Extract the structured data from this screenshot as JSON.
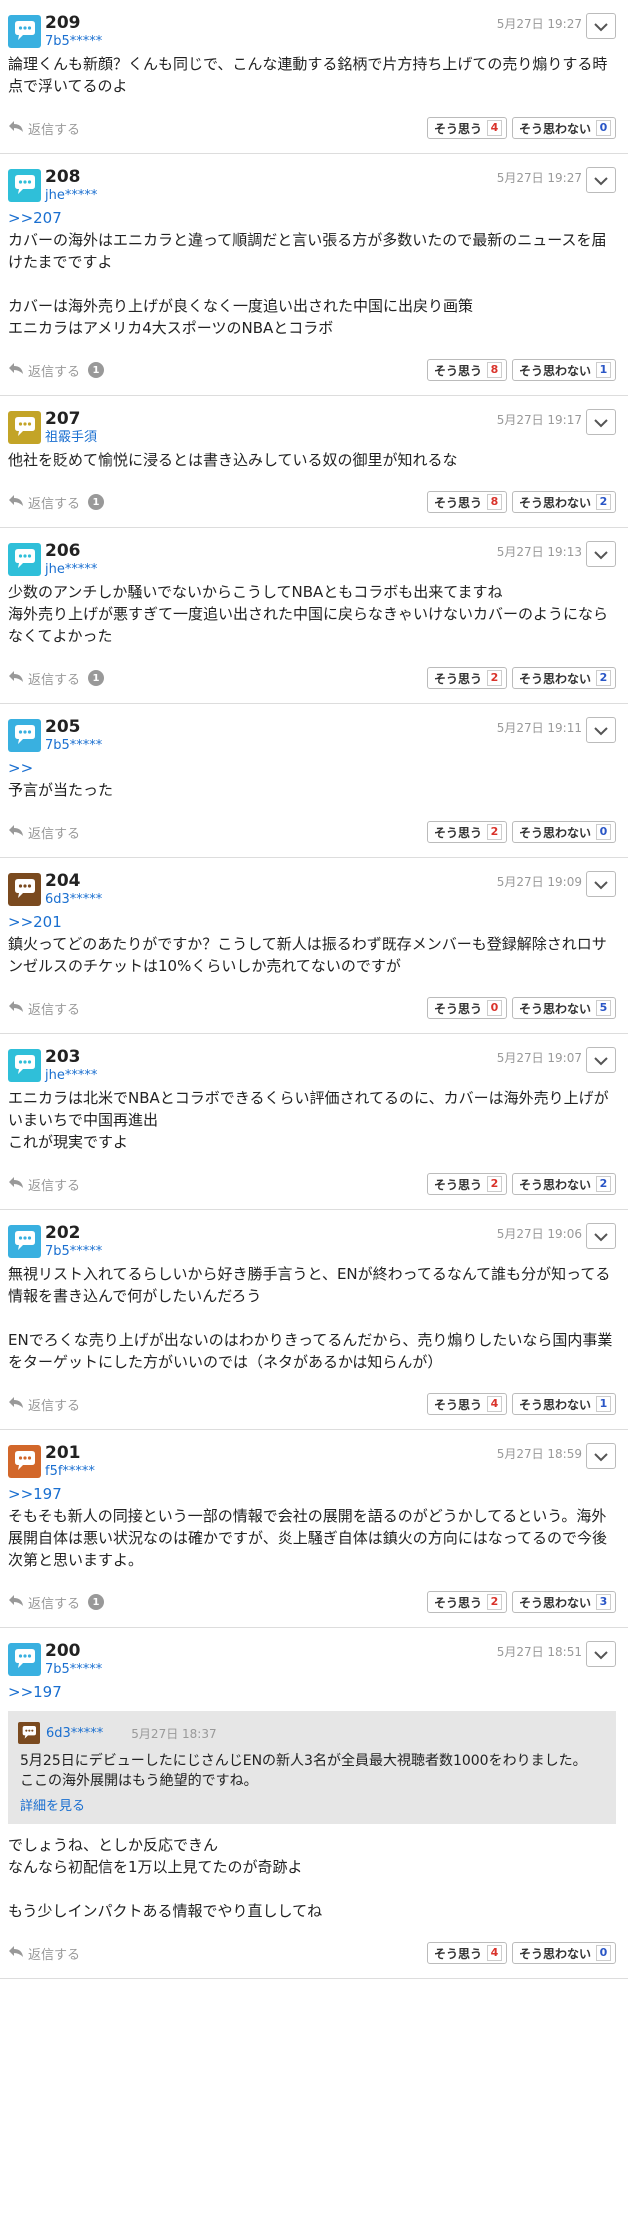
{
  "labels": {
    "reply": "返信する",
    "agree": "そう思う",
    "disagree": "そう思わない",
    "details": "詳細を見る"
  },
  "colors": {
    "link": "#1a6fd0",
    "agree_count": "#d9332b",
    "disagree_count": "#2a56c6"
  },
  "posts": [
    {
      "number": "209",
      "user": "7b5*****",
      "date": "5月27日 19:27",
      "avatar": {
        "icon": "speech-bubble-icon",
        "color": "#39b0e0"
      },
      "reply_to": "",
      "text": "論理くんも新顔？くんも同じで、こんな連動する銘柄で片方持ち上げての売り煽りする時点で浮いてるのよ",
      "reply_count": "",
      "agree": "4",
      "disagree": "0"
    },
    {
      "number": "208",
      "user": "jhe*****",
      "date": "5月27日 19:27",
      "avatar": {
        "icon": "speech-bubble-icon",
        "color": "#2fbfd9"
      },
      "reply_to": ">>207",
      "text": "カバーの海外はエニカラと違って順調だと言い張る方が多数いたので最新のニュースを届けたまでですよ\n\nカバーは海外売り上げが良くなく一度追い出された中国に出戻り画策\nエニカラはアメリカ4大スポーツのNBAとコラボ",
      "reply_count": "1",
      "agree": "8",
      "disagree": "1"
    },
    {
      "number": "207",
      "user": "祖霰手須",
      "date": "5月27日 19:17",
      "avatar": {
        "icon": "speech-bubble-icon",
        "color": "#c3a427"
      },
      "reply_to": "",
      "text": "他社を貶めて愉悦に浸るとは書き込みしている奴の御里が知れるな",
      "reply_count": "1",
      "agree": "8",
      "disagree": "2"
    },
    {
      "number": "206",
      "user": "jhe*****",
      "date": "5月27日 19:13",
      "avatar": {
        "icon": "speech-bubble-icon",
        "color": "#2fbfd9"
      },
      "reply_to": "",
      "text": "少数のアンチしか騒いでないからこうしてNBAともコラボも出来てますね\n海外売り上げが悪すぎて一度追い出された中国に戻らなきゃいけないカバーのようにならなくてよかった",
      "reply_count": "1",
      "agree": "2",
      "disagree": "2"
    },
    {
      "number": "205",
      "user": "7b5*****",
      "date": "5月27日 19:11",
      "avatar": {
        "icon": "speech-bubble-icon",
        "color": "#39b0e0"
      },
      "reply_to": ">>",
      "text": "予言が当たった",
      "reply_count": "",
      "agree": "2",
      "disagree": "0"
    },
    {
      "number": "204",
      "user": "6d3*****",
      "date": "5月27日 19:09",
      "avatar": {
        "icon": "speech-bubble-icon",
        "color": "#7a4a1f"
      },
      "reply_to": ">>201",
      "text": "鎮火ってどのあたりがですか？こうして新人は振るわず既存メンバーも登録解除されロサンゼルスのチケットは10%くらいしか売れてないのですが",
      "reply_count": "",
      "agree": "0",
      "disagree": "5"
    },
    {
      "number": "203",
      "user": "jhe*****",
      "date": "5月27日 19:07",
      "avatar": {
        "icon": "speech-bubble-icon",
        "color": "#2fbfd9"
      },
      "reply_to": "",
      "text": "エニカラは北米でNBAとコラボできるくらい評価されてるのに、カバーは海外売り上げがいまいちで中国再進出\nこれが現実ですよ",
      "reply_count": "",
      "agree": "2",
      "disagree": "2"
    },
    {
      "number": "202",
      "user": "7b5*****",
      "date": "5月27日 19:06",
      "avatar": {
        "icon": "speech-bubble-icon",
        "color": "#39b0e0"
      },
      "reply_to": "",
      "text": "無視リスト入れてるらしいから好き勝手言うと、ENが終わってるなんて誰も分が知ってる情報を書き込んで何がしたいんだろう\n\nENでろくな売り上げが出ないのはわかりきってるんだから、売り煽りしたいなら国内事業をターゲットにした方がいいのでは（ネタがあるかは知らんが）",
      "reply_count": "",
      "agree": "4",
      "disagree": "1"
    },
    {
      "number": "201",
      "user": "f5f*****",
      "date": "5月27日 18:59",
      "avatar": {
        "icon": "speech-bubble-icon",
        "color": "#d2672a"
      },
      "reply_to": ">>197",
      "text": "そもそも新人の同接という一部の情報で会社の展開を語るのがどうかしてるという。海外展開自体は悪い状況なのは確かですが、炎上騒ぎ自体は鎮火の方向にはなってるので今後次第と思いますよ。",
      "reply_count": "1",
      "agree": "2",
      "disagree": "3"
    },
    {
      "number": "200",
      "user": "7b5*****",
      "date": "5月27日 18:51",
      "avatar": {
        "icon": "speech-bubble-icon",
        "color": "#39b0e0"
      },
      "reply_to": ">>197",
      "quote": {
        "user": "6d3*****",
        "date": "5月27日 18:37",
        "text": "5月25日にデビューしたにじさんじENの新人3名が全員最大視聴者数1000をわりました。\nここの海外展開はもう絶望的ですね。"
      },
      "text": "でしょうね、としか反応できん\nなんなら初配信を1万以上見てたのが奇跡よ\n\nもう少しインパクトある情報でやり直ししてね",
      "reply_count": "",
      "agree": "4",
      "disagree": "0"
    }
  ]
}
